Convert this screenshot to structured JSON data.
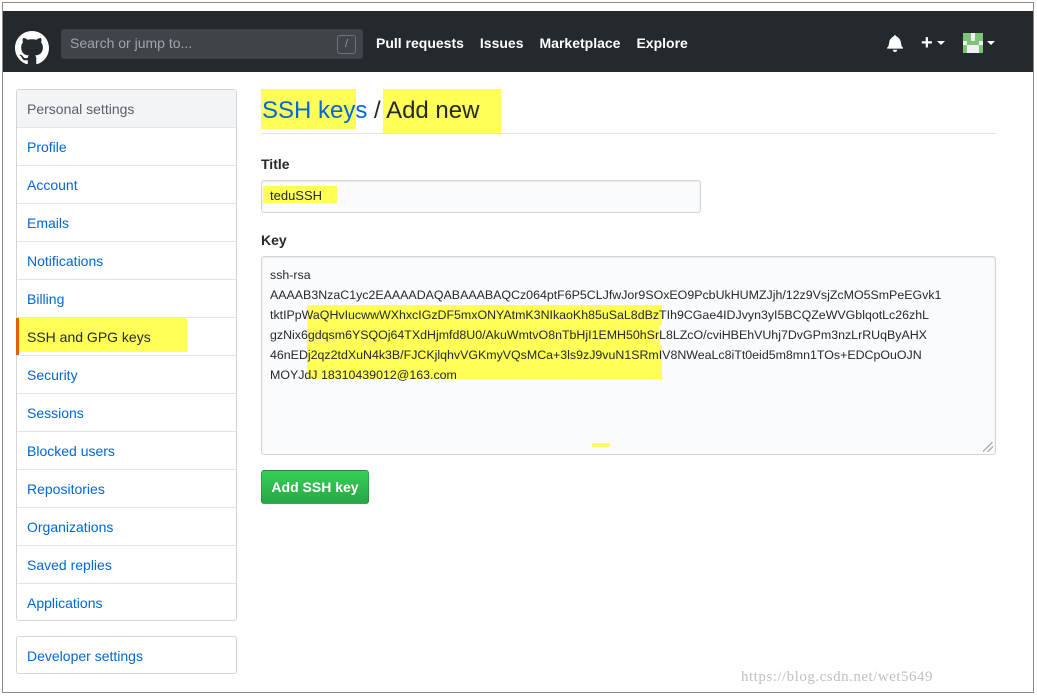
{
  "header": {
    "search_placeholder": "Search or jump to...",
    "search_shortcut": "/",
    "nav": [
      "Pull requests",
      "Issues",
      "Marketplace",
      "Explore"
    ],
    "new_symbol": "+"
  },
  "sidebar": {
    "heading": "Personal settings",
    "items": [
      {
        "label": "Profile"
      },
      {
        "label": "Account"
      },
      {
        "label": "Emails"
      },
      {
        "label": "Notifications"
      },
      {
        "label": "Billing"
      },
      {
        "label": "SSH and GPG keys"
      },
      {
        "label": "Security"
      },
      {
        "label": "Sessions"
      },
      {
        "label": "Blocked users"
      },
      {
        "label": "Repositories"
      },
      {
        "label": "Organizations"
      },
      {
        "label": "Saved replies"
      },
      {
        "label": "Applications"
      }
    ],
    "selected_index": 5,
    "developer_settings": "Developer settings"
  },
  "main": {
    "breadcrumb": "SSH keys",
    "separator": " / ",
    "page_title": "Add new",
    "title_label": "Title",
    "title_value": "teduSSH",
    "key_label": "Key",
    "key_lines": [
      "ssh-rsa",
      "AAAAB3NzaC1yc2EAAAADAQABAAABAQCz064ptF6P5CLJfwJor9SOxEO9PcbUkHUMZJjh/12z9VsjZcMO5SmPeEGvk1",
      "tktIPpWaQHvIucwwWXhxcIGzDF5mxONYAtmK3NIkaoKh85uSaL8dBzTIh9CGae4IDJvyn3yI5BCQZeWVGblqotLc26zhL",
      "gzNix6gdqsm6YSQOj64TXdHjmfd8U0/AkuWmtvO8nTbHjI1EMH50hSrL8LZcO/cviHBEhVUhj7DvGPm3nzLrRUqByAHX",
      "46nEDj2qz2tdXuN4k3B/FJCKjlqhvVGKmyVQsMCa+3ls9zJ9vuN1SRmIV8NWeaLc8iTt0eid5m8mn1TOs+EDCpOuOJN",
      "MOYJdJ 18310439012@163.com"
    ],
    "submit_label": "Add SSH key"
  },
  "watermark": "https://blog.csdn.net/wet5649"
}
